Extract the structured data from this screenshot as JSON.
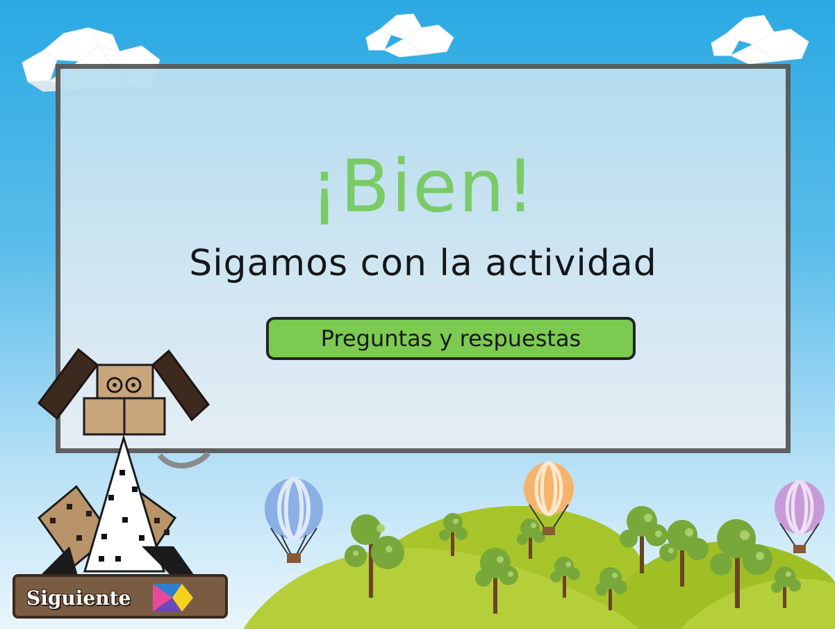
{
  "feedback": {
    "title": "¡Bien!",
    "subtitle": "Sigamos con la actividad",
    "activity_button_label": "Preguntas y respuestas"
  },
  "navigation": {
    "next_label": "Siguiente"
  },
  "colors": {
    "sky_top": "#2aa9e3",
    "title_green": "#7ccc63",
    "button_green": "#7ccb4a",
    "panel_border": "#5b5a58",
    "hill_green": "#a8c62a",
    "next_button_brown": "#7a5c43"
  }
}
